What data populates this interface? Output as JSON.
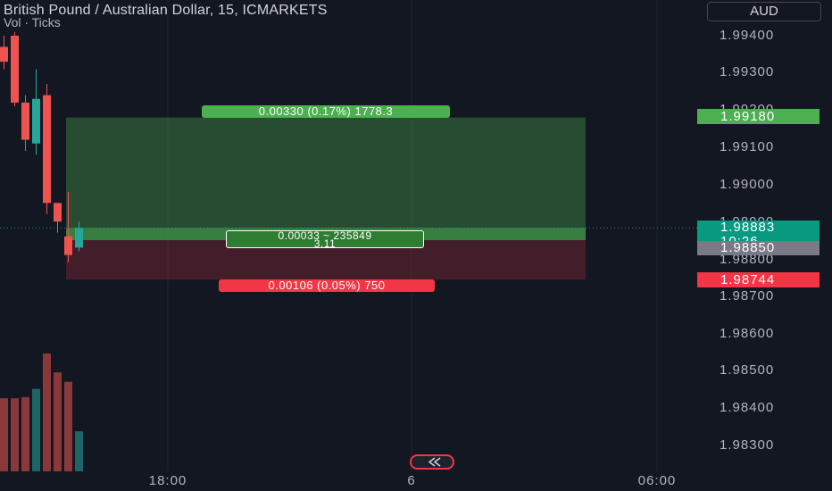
{
  "header": {
    "title": "British Pound / Australian Dollar, 15, ICMARKETS",
    "subtitle": "Vol · Ticks",
    "currency": "AUD"
  },
  "price_axis": {
    "ticks": [
      "1.99400",
      "1.99300",
      "1.99200",
      "1.99100",
      "1.99000",
      "1.98900",
      "1.98800",
      "1.98700",
      "1.98600",
      "1.98500",
      "1.98400",
      "1.98300"
    ]
  },
  "price_tags": {
    "target": "1.99180",
    "current": "1.98883",
    "countdown": "10:26",
    "entry": "1.98850",
    "stop": "1.98744"
  },
  "time_axis": {
    "ticks": [
      "18:00",
      "6",
      "06:00"
    ]
  },
  "position_tool": {
    "target_label": "0.00330 (0.17%) 1778.3",
    "center_line1": "0.00033 ~ 235849",
    "center_line2": "3.11",
    "stop_label": "0.00106 (0.05%) 750"
  },
  "colors": {
    "background": "#131722",
    "up": "#26a69a",
    "down": "#ef5350",
    "target_green": "#4caf50",
    "stop_red": "#f23645",
    "current_teal": "#089981",
    "entry_gray": "#787b86"
  },
  "icons": {
    "goto_realtime": "scroll-to-realtime-icon"
  },
  "chart_data": {
    "type": "candlestick",
    "title": "British Pound / Australian Dollar, 15, ICMARKETS",
    "ylim": [
      1.9824,
      1.995
    ],
    "candles": [
      {
        "open": 1.9937,
        "high": 1.994,
        "low": 1.9931,
        "close": 1.9933
      },
      {
        "open": 1.994,
        "high": 1.9941,
        "low": 1.9921,
        "close": 1.9922
      },
      {
        "open": 1.9922,
        "high": 1.9924,
        "low": 1.9909,
        "close": 1.9912
      },
      {
        "open": 1.9911,
        "high": 1.9931,
        "low": 1.9908,
        "close": 1.9923
      },
      {
        "open": 1.9924,
        "high": 1.9927,
        "low": 1.9892,
        "close": 1.9895
      },
      {
        "open": 1.9895,
        "high": 1.9895,
        "low": 1.9887,
        "close": 1.989
      },
      {
        "open": 1.9886,
        "high": 1.9898,
        "low": 1.9879,
        "close": 1.9881
      },
      {
        "open": 1.9883,
        "high": 1.989,
        "low": 1.9882,
        "close": 1.98883
      }
    ],
    "volume": [
      62,
      62,
      63,
      70,
      100,
      84,
      76,
      34
    ],
    "position": {
      "target": 1.9918,
      "entry": 1.9885,
      "stop": 1.98744,
      "current": 1.98883
    }
  }
}
